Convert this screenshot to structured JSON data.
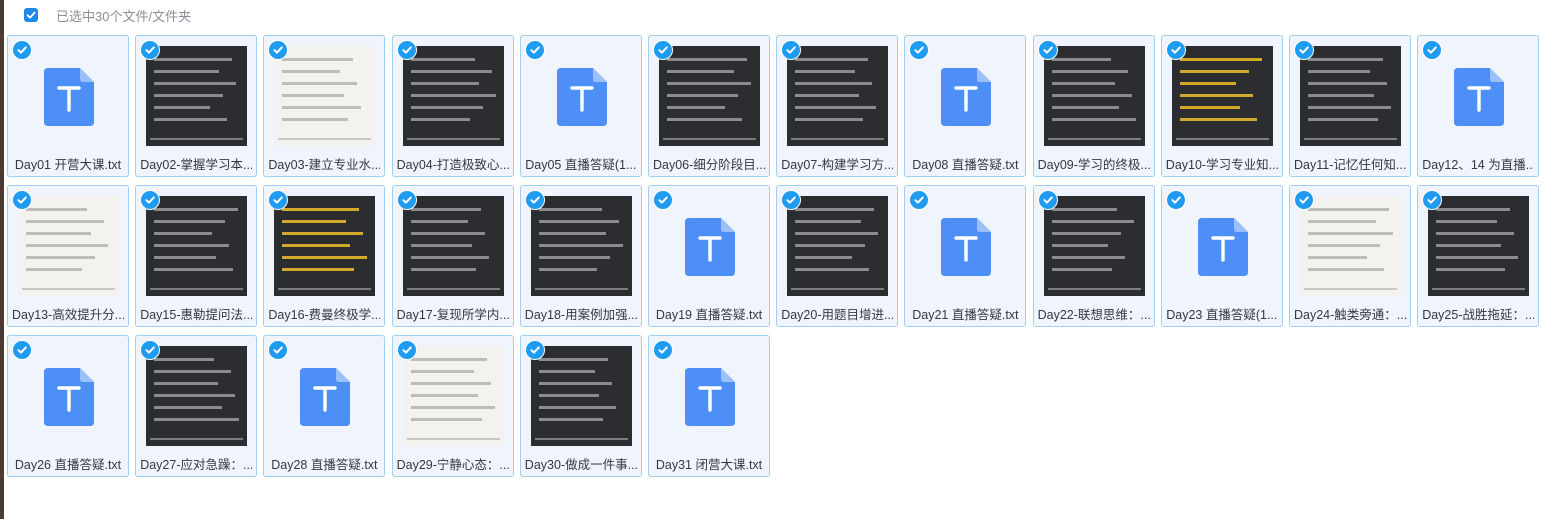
{
  "header": {
    "selected_label": "已选中30个文件/文件夹"
  },
  "colors": {
    "accent": "#1f9bf2",
    "card_bg": "#f0f5fd",
    "card_border": "#9fd0f3",
    "txt_icon": "#4d8ef7"
  },
  "files": [
    {
      "name": "Day01 开营大课.txt",
      "kind": "txt"
    },
    {
      "name": "Day02-掌握学习本...",
      "kind": "image"
    },
    {
      "name": "Day03-建立专业水...",
      "kind": "image"
    },
    {
      "name": "Day04-打造极致心...",
      "kind": "image"
    },
    {
      "name": "Day05 直播答疑(1...",
      "kind": "txt"
    },
    {
      "name": "Day06-细分阶段目...",
      "kind": "image"
    },
    {
      "name": "Day07-构建学习方...",
      "kind": "image"
    },
    {
      "name": "Day08 直播答疑.txt",
      "kind": "txt"
    },
    {
      "name": "Day09-学习的终极...",
      "kind": "image"
    },
    {
      "name": "Day10-学习专业知...",
      "kind": "image"
    },
    {
      "name": "Day11-记忆任何知...",
      "kind": "image"
    },
    {
      "name": "Day12、14 为直播...",
      "kind": "txt"
    },
    {
      "name": "Day13-高效提升分...",
      "kind": "image"
    },
    {
      "name": "Day15-惠勒提问法...",
      "kind": "image"
    },
    {
      "name": "Day16-费曼终极学...",
      "kind": "image"
    },
    {
      "name": "Day17-复现所学内...",
      "kind": "image"
    },
    {
      "name": "Day18-用案例加强...",
      "kind": "image"
    },
    {
      "name": "Day19 直播答疑.txt",
      "kind": "txt"
    },
    {
      "name": "Day20-用题目增进...",
      "kind": "image"
    },
    {
      "name": "Day21 直播答疑.txt",
      "kind": "txt"
    },
    {
      "name": "Day22-联想思维：...",
      "kind": "image"
    },
    {
      "name": "Day23 直播答疑(1...",
      "kind": "txt"
    },
    {
      "name": "Day24-触类旁通：...",
      "kind": "image"
    },
    {
      "name": "Day25-战胜拖延：...",
      "kind": "image"
    },
    {
      "name": "Day26 直播答疑.txt",
      "kind": "txt"
    },
    {
      "name": "Day27-应对急躁：...",
      "kind": "image"
    },
    {
      "name": "Day28 直播答疑.txt",
      "kind": "txt"
    },
    {
      "name": "Day29-宁静心态：...",
      "kind": "image"
    },
    {
      "name": "Day30-做成一件事...",
      "kind": "image"
    },
    {
      "name": "Day31 闭营大课.txt",
      "kind": "txt"
    }
  ]
}
